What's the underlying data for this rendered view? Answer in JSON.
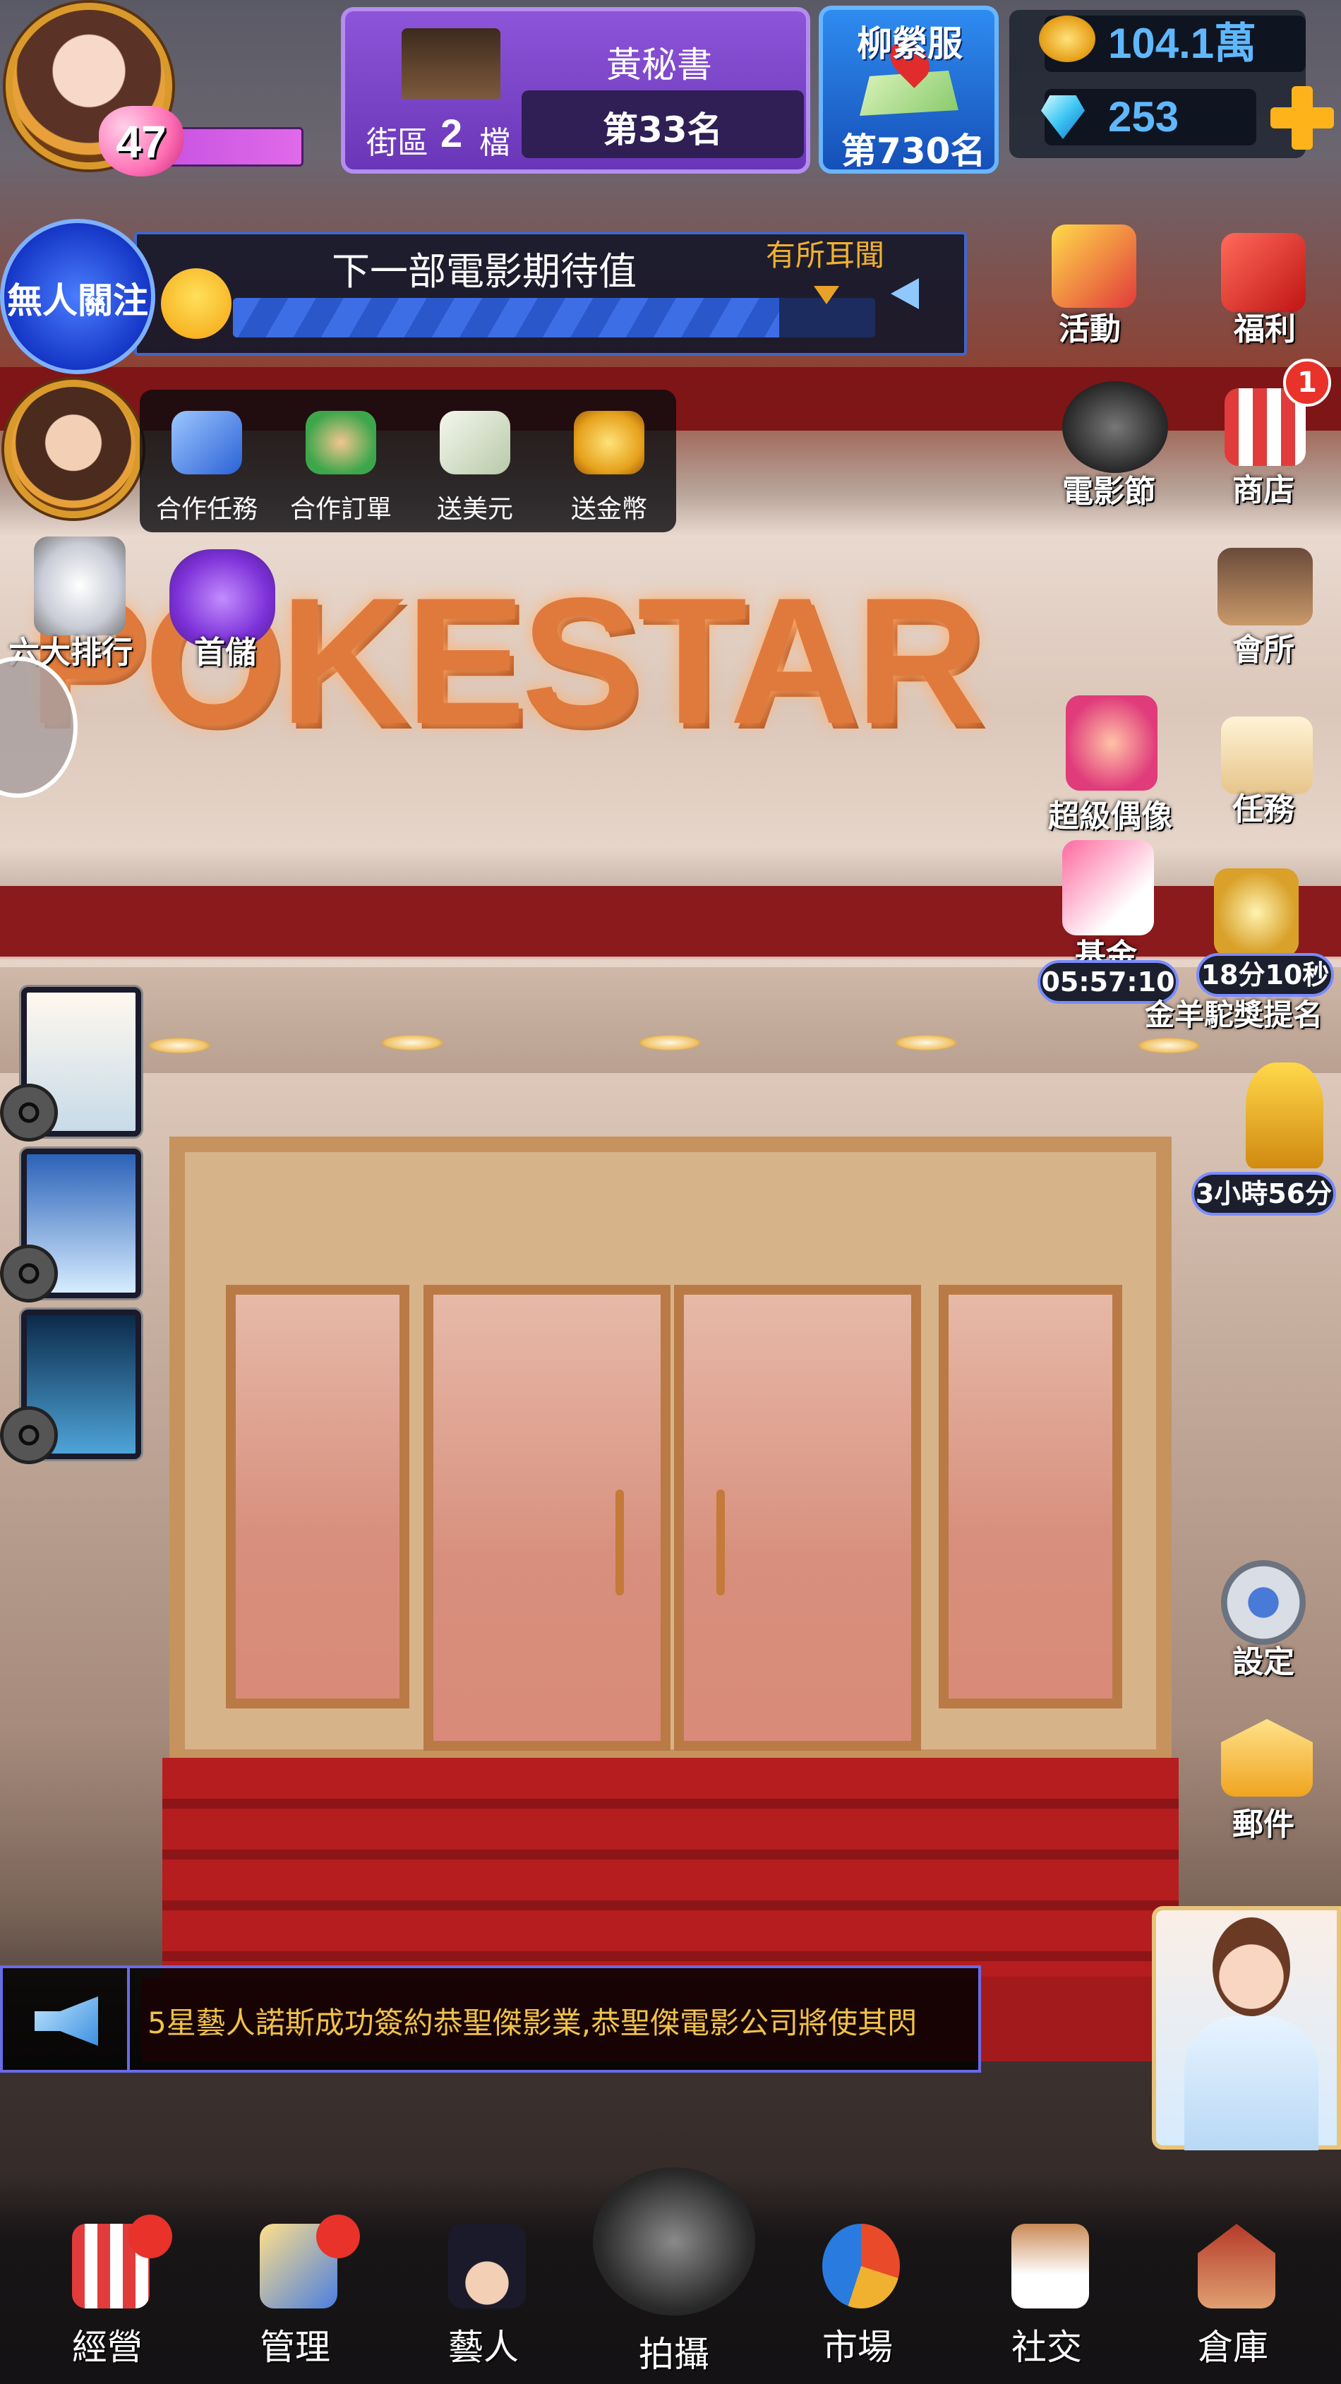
{
  "player": {
    "level": "47"
  },
  "studio": {
    "district_label": "街區",
    "district_num": "2",
    "district_unit": "檔",
    "secretary": "黃秘書",
    "rank": "第33名"
  },
  "server": {
    "name": "柳縈服",
    "rank": "第730名"
  },
  "resources": {
    "coins": "104.1萬",
    "gems": "253"
  },
  "followers": {
    "label": "無人關注"
  },
  "anticipation": {
    "title": "下一部電影期待值",
    "level": "有所耳聞",
    "fill_fraction": 0.85
  },
  "actions": [
    {
      "label": "合作任務",
      "icon": "handshake-icon"
    },
    {
      "label": "合作訂單",
      "icon": "handshake-pin-icon"
    },
    {
      "label": "送美元",
      "icon": "dollar-bills-icon"
    },
    {
      "label": "送金幣",
      "icon": "gold-coins-icon"
    }
  ],
  "left_menu": {
    "ranking": "六大排行",
    "first_topup": "首儲"
  },
  "right_menu": {
    "events": "活動",
    "welfare": "福利",
    "film_festival": "電影節",
    "shop": "商店",
    "shop_badge": "1",
    "club": "會所",
    "superidol": "超級偶像",
    "tasks": "任務",
    "fund": "基金",
    "fund_timer": "05:57:10",
    "award_timer": "18分10秒",
    "award_label": "金羊駝獎提名",
    "trophy_timer": "3小時56分",
    "settings": "設定",
    "mail": "郵件"
  },
  "brand": {
    "logo_text": "POKESTAR"
  },
  "ticker": {
    "message": "5星藝人諾斯成功簽約恭聖傑影業,恭聖傑電影公司將使其閃"
  },
  "nav": [
    {
      "label": "經營",
      "icon": "popcorn-ticket-icon",
      "dot": true
    },
    {
      "label": "管理",
      "icon": "management-tools-icon",
      "dot": true
    },
    {
      "label": "藝人",
      "icon": "agent-hat-icon",
      "dot": false
    },
    {
      "label": "拍攝",
      "icon": "film-camera-icon",
      "dot": false
    },
    {
      "label": "市場",
      "icon": "pie-chart-icon",
      "dot": false
    },
    {
      "label": "社交",
      "icon": "coffee-cup-icon",
      "dot": false
    },
    {
      "label": "倉庫",
      "icon": "warehouse-icon",
      "dot": false
    }
  ],
  "colors": {
    "accent_gold": "#f0c24a",
    "resource_blue": "#5fb8ff",
    "badge_red": "#e8322a",
    "banner_red": "#7e1517"
  }
}
